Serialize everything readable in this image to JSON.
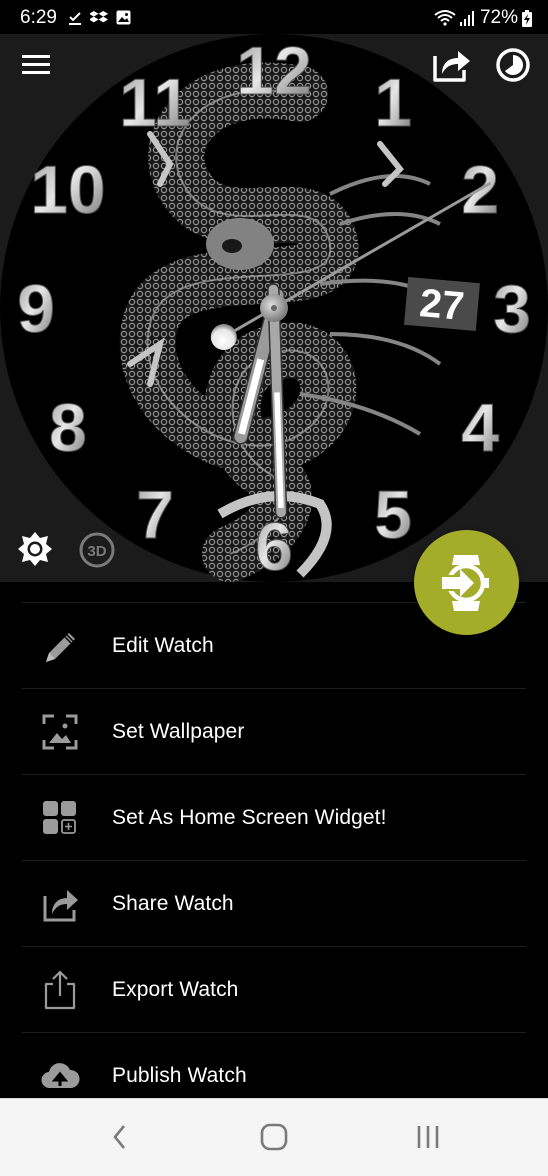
{
  "status_bar": {
    "time": "6:29",
    "left_icons": [
      "download-done-icon",
      "dropbox-icon",
      "gallery-icon"
    ],
    "right_icons": [
      "wifi-icon",
      "signal-icon",
      "battery-charging-icon"
    ],
    "battery": "72%"
  },
  "header": {
    "menu_icon": "hamburger-menu-icon",
    "share_icon": "share-icon",
    "theme_icon": "theme-toggle-icon"
  },
  "watch_face": {
    "theme": "dragon",
    "numerals": [
      "12",
      "1",
      "2",
      "3",
      "4",
      "5",
      "6",
      "7",
      "8",
      "9",
      "10",
      "11"
    ],
    "date_window": "27",
    "time": {
      "hour": 6,
      "minute": 29,
      "second": 40
    },
    "colors": {
      "face": "#000000",
      "numerals": "#c8c8c8",
      "date_bg": "#4a4a4a"
    }
  },
  "preview_controls": {
    "brightness_icon": "brightness-icon",
    "threed_label": "3D"
  },
  "fab": {
    "icon": "sync-to-watch-icon",
    "color": "#a4ad2a"
  },
  "menu": {
    "items": [
      {
        "label": "Edit Watch",
        "icon": "pencil-icon"
      },
      {
        "label": "Set Wallpaper",
        "icon": "wallpaper-icon"
      },
      {
        "label": "Set As Home Screen Widget!",
        "icon": "widget-icon"
      },
      {
        "label": "Share Watch",
        "icon": "share-icon"
      },
      {
        "label": "Export Watch",
        "icon": "export-icon"
      },
      {
        "label": "Publish Watch",
        "icon": "cloud-upload-icon"
      }
    ]
  },
  "nav_bar": {
    "back": "back-icon",
    "home": "home-icon",
    "recents": "recents-icon"
  }
}
